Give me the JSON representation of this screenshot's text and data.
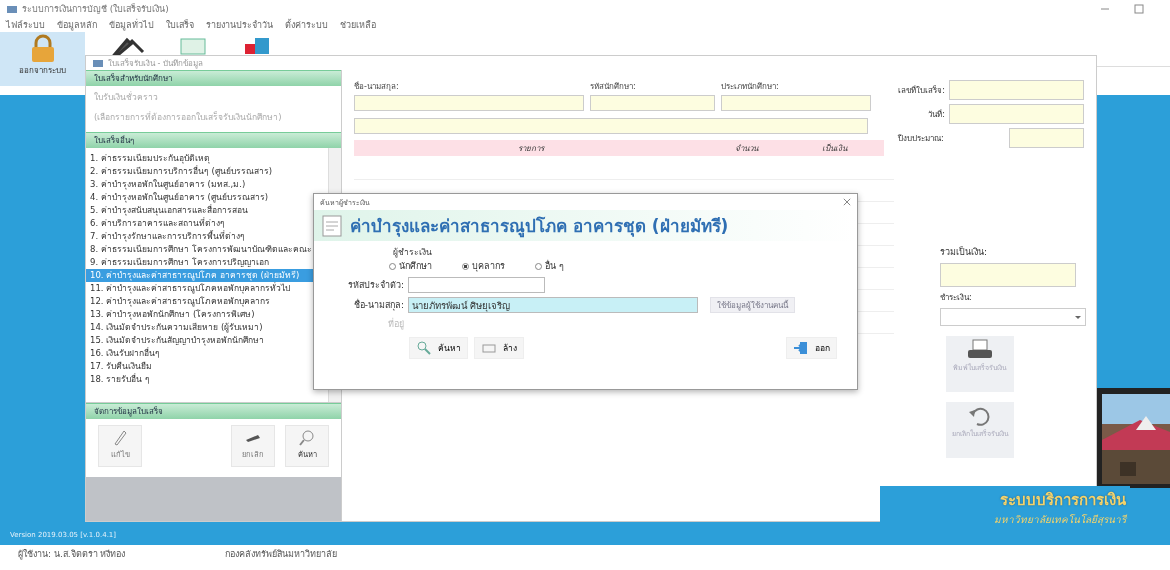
{
  "app": {
    "title": "ระบบการเงินการบัญชี (ใบเสร็จรับเงิน)",
    "menu": [
      "ไฟล์ระบบ",
      "ข้อมูลหลัก",
      "ข้อมูลทั่วไป",
      "ใบเสร็จ",
      "รายงานประจำวัน",
      "ตั้งค่าระบบ",
      "ช่วยเหลือ"
    ],
    "logout": "ออกจากระบบ"
  },
  "window": {
    "title": "ใบเสร็จรับเงิน - บันทึกข้อมูล",
    "student_section": {
      "title": "ใบเสร็จสำหรับนักศึกษา",
      "items": [
        "ใบรับเงินชั่วคราว",
        "(เลือกรายการที่ต้องการออกใบเสร็จรับเงินนักศึกษา)"
      ]
    },
    "other_section": {
      "title": "ใบเสร็จอื่นๆ",
      "items": [
        {
          "label": "1. ค่าธรรมเนียมประกันอุบัติเหตุ",
          "selected": false
        },
        {
          "label": "2. ค่าธรรมเนียมการบริการอื่นๆ (ศูนย์บรรณสาร)",
          "selected": false
        },
        {
          "label": "3. ค่าบำรุงหอพักในศูนย์อาคาร (มทส.,ม.)",
          "selected": false
        },
        {
          "label": "4. ค่าบำรุงหอพักในศูนย์อาคาร (ศูนย์บรรณสาร)",
          "selected": false
        },
        {
          "label": "5. ค่าบำรุงสนับสนุนเอกสารและสื่อการสอน",
          "selected": false
        },
        {
          "label": "6. ค่าบริการอาคารและสถานที่ต่างๆ",
          "selected": false
        },
        {
          "label": "7. ค่าบำรุงรักษาและการบริการพื้นที่ต่างๆ",
          "selected": false
        },
        {
          "label": "8. ค่าธรรมเนียมการศึกษา โครงการพัฒนาบัณฑิตและคณะ",
          "selected": false
        },
        {
          "label": "9. ค่าธรรมเนียมการศึกษา โครงการปริญญาเอก",
          "selected": false
        },
        {
          "label": "10. ค่าบำรุงและค่าสาธารณูปโภค อาคารชุด (ฝ่ายมัทรี)",
          "selected": true
        },
        {
          "label": "11. ค่าบำรุงและค่าสาธารณูปโภคหอพักบุคลากรทั่วไป",
          "selected": false
        },
        {
          "label": "12. ค่าบำรุงและค่าสาธารณูปโภคหอพักบุคลากร",
          "selected": false
        },
        {
          "label": "13. ค่าบำรุงหอพักนักศึกษา (โครงการพิเศษ)",
          "selected": false
        },
        {
          "label": "14. เงินมัดจำประกันความเสียหาย (ผู้รับเหมา)",
          "selected": false
        },
        {
          "label": "15. เงินมัดจำประกันสัญญาบำรุงหอพักนักศึกษา",
          "selected": false
        },
        {
          "label": "16. เงินรับฝากอื่นๆ",
          "selected": false
        },
        {
          "label": "17. รับคืนเงินยืม",
          "selected": false
        },
        {
          "label": "18. รายรับอื่น ๆ",
          "selected": false
        }
      ]
    },
    "manage_section": {
      "title": "จัดการข้อมูลใบเสร็จ",
      "buttons": [
        {
          "kind": "edit",
          "label": "แก้ไข",
          "disabled": true
        },
        {
          "kind": "cancel",
          "label": "ยกเลิก",
          "disabled": true
        },
        {
          "kind": "search",
          "label": "ค้นหา",
          "disabled": false
        }
      ]
    },
    "form": {
      "name_label": "ชื่อ-นามสกุล:",
      "student_id_label": "รหัสนักศึกษา:",
      "student_type_label": "ประเภทนักศึกษา:",
      "receipt_no_label": "เลขที่ใบเสร็จ:",
      "date_label": "วันที่:",
      "fiscal_year_label": "ปีงบประมาณ:",
      "columns": [
        "รายการ",
        "จำนวน",
        "เป็นเงิน"
      ],
      "total_label": "รวมเป็นเงิน:",
      "payment_label": "ชำระเงิน:",
      "print_button": {
        "label": "พิมพ์ใบเสร็จรับเงิน",
        "disabled": true
      },
      "cancel_button": {
        "label": "ยกเลิกใบเสร็จรับเงิน",
        "disabled": true
      }
    }
  },
  "dialog": {
    "title": "ค้นหาผู้ชำระเงิน",
    "heading": "ค่าบำรุงและค่าสาธารณูปโภค อาคารชุด (ฝ่ายมัทรี)",
    "payer_label": "ผู้ชำระเงิน",
    "payer_options": [
      {
        "label": "นักศึกษา",
        "selected": false
      },
      {
        "label": "บุคลากร",
        "selected": true
      },
      {
        "label": "อื่น ๆ",
        "selected": false
      }
    ],
    "id_label": "รหัสประจำตัว:",
    "name_label": "ชื่อ-นามสกุล:",
    "name_value": "นายภัทรพัฒน์ ศิษยุเจริญ",
    "address_label": "ที่อยู่",
    "lookup_button": {
      "label": "ใช้ข้อมูลผู้ใช้งานคนนี้",
      "disabled": true
    },
    "search_button": "ค้นหา",
    "clear_button": "ล้าง",
    "exit_button": "ออก"
  },
  "logo": {
    "title": "ระบบบริการการเงิน",
    "subtitle": "มหาวิทยาลัยเทคโนโลยีสุรนารี"
  },
  "status_bar": {
    "version": "Version 2019.03.05 [v.1.0.4.1]",
    "user": "ผู้ใช้งาน: น.ส.จิตตรา หงีทอง",
    "unit": "กองคลังทรัพย์สินมหาวิทยาลัย"
  }
}
